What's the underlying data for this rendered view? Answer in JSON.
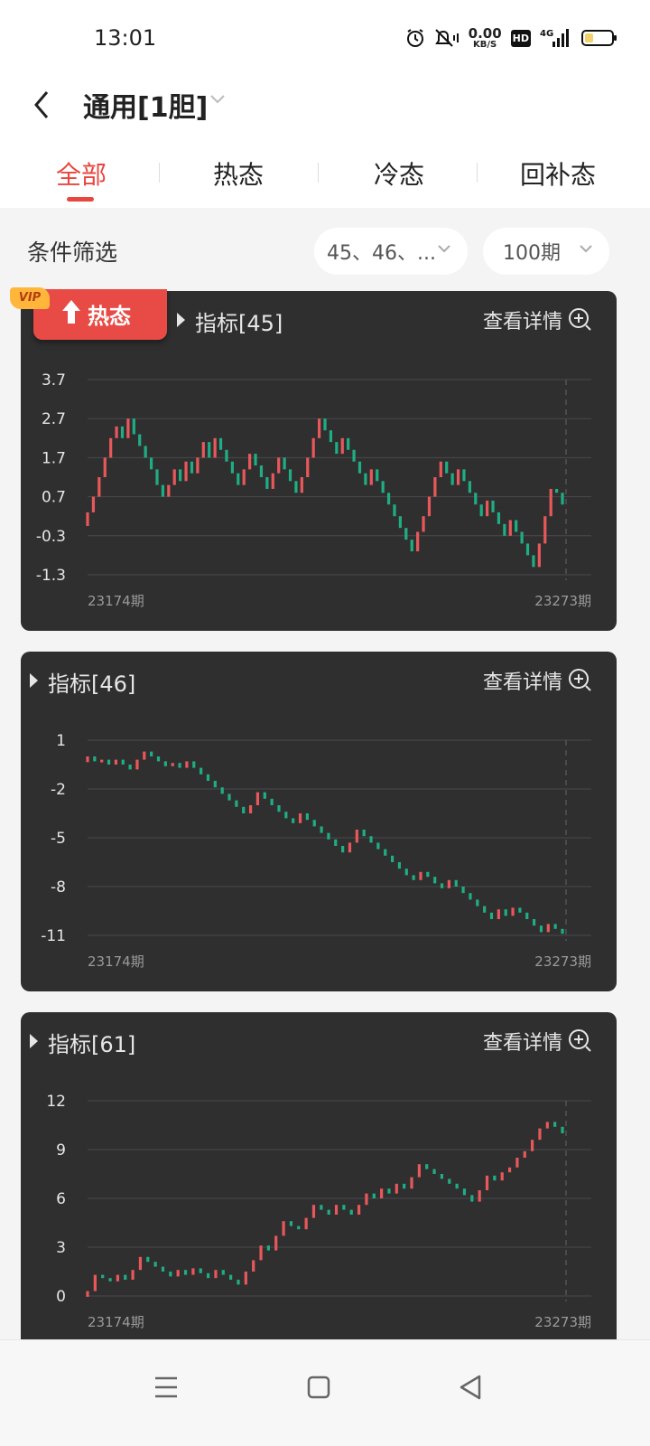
{
  "status_bar": {
    "time": "13:01",
    "net_speed_value": "0.00",
    "net_speed_unit": "KB/S",
    "hd_badge": "HD",
    "network": "4G",
    "icons": [
      "alarm-icon",
      "mute-icon",
      "signal-icon",
      "battery-icon"
    ]
  },
  "header": {
    "title": "通用[1胆]",
    "back_icon": "chevron-left-icon",
    "dropdown_icon": "chevron-down-icon"
  },
  "tabs": [
    {
      "label": "全部",
      "active": true
    },
    {
      "label": "热态",
      "active": false
    },
    {
      "label": "冷态",
      "active": false
    },
    {
      "label": "回补态",
      "active": false
    }
  ],
  "filter": {
    "label": "条件筛选",
    "indicators_value": "45、46、...",
    "periods_value": "100期"
  },
  "colors": {
    "accent": "#e8463f",
    "card_bg": "#2f2f30",
    "up_bar": "#e8585a",
    "down_bar": "#1fae83"
  },
  "cards": [
    {
      "name": "指标[45]",
      "detail_label": "查看详情",
      "badge": {
        "vip": "VIP",
        "text": "热态",
        "icon": "arrow-up-icon"
      },
      "chart_data": {
        "type": "line",
        "y_ticks": [
          "3.7",
          "2.7",
          "1.7",
          "0.7",
          "-0.3",
          "-1.3"
        ],
        "ylim": [
          -1.3,
          3.7
        ],
        "x_start_label": "23174期",
        "x_end_label": "23273期",
        "values": [
          0.3,
          0.7,
          1.2,
          1.7,
          2.2,
          2.5,
          2.2,
          2.7,
          2.3,
          2.0,
          1.7,
          1.4,
          1.0,
          0.7,
          1.0,
          1.4,
          1.1,
          1.6,
          1.3,
          1.7,
          2.1,
          1.7,
          2.2,
          1.9,
          1.6,
          1.3,
          1.0,
          1.4,
          1.8,
          1.5,
          1.2,
          0.9,
          1.3,
          1.7,
          1.4,
          1.1,
          0.8,
          1.2,
          1.7,
          2.2,
          2.7,
          2.4,
          2.1,
          1.8,
          2.2,
          1.9,
          1.6,
          1.3,
          1.0,
          1.4,
          1.1,
          0.8,
          0.5,
          0.2,
          -0.1,
          -0.4,
          -0.7,
          -0.2,
          0.2,
          0.7,
          1.2,
          1.6,
          1.3,
          1.0,
          1.4,
          1.1,
          0.8,
          0.5,
          0.2,
          0.6,
          0.3,
          0.0,
          -0.3,
          0.1,
          -0.2,
          -0.5,
          -0.8,
          -1.1,
          -0.5,
          0.2,
          0.9,
          0.8,
          0.5
        ]
      }
    },
    {
      "name": "指标[46]",
      "detail_label": "查看详情",
      "chart_data": {
        "type": "line",
        "y_ticks": [
          "1",
          "-2",
          "-5",
          "-8",
          "-11"
        ],
        "ylim": [
          -11,
          1
        ],
        "x_start_label": "23174期",
        "x_end_label": "23273期",
        "values": [
          0,
          -0.3,
          -0.2,
          -0.5,
          -0.2,
          -0.5,
          -0.8,
          -0.2,
          0.3,
          0,
          -0.3,
          -0.6,
          -0.4,
          -0.7,
          -0.3,
          -0.7,
          -1.1,
          -1.5,
          -1.9,
          -2.3,
          -2.7,
          -3.1,
          -3.5,
          -3.0,
          -2.2,
          -2.6,
          -3.0,
          -3.4,
          -3.8,
          -4.1,
          -3.5,
          -3.9,
          -4.3,
          -4.7,
          -5.1,
          -5.5,
          -5.9,
          -5.3,
          -4.5,
          -4.9,
          -5.3,
          -5.7,
          -6.1,
          -6.5,
          -6.9,
          -7.3,
          -7.6,
          -7.1,
          -7.4,
          -7.8,
          -8.1,
          -7.6,
          -8.0,
          -8.4,
          -8.8,
          -9.2,
          -9.6,
          -10.0,
          -9.4,
          -9.8,
          -9.3,
          -9.6,
          -10.0,
          -10.4,
          -10.8,
          -10.3,
          -10.6,
          -10.9
        ]
      }
    },
    {
      "name": "指标[61]",
      "detail_label": "查看详情",
      "chart_data": {
        "type": "line",
        "y_ticks": [
          "12",
          "9",
          "6",
          "3",
          "0"
        ],
        "ylim": [
          0,
          12
        ],
        "x_start_label": "23174期",
        "x_end_label": "23273期",
        "values": [
          0.3,
          1.3,
          1.1,
          0.9,
          1.3,
          1.0,
          1.6,
          2.4,
          2.1,
          1.8,
          1.5,
          1.2,
          1.6,
          1.3,
          1.7,
          1.4,
          1.1,
          1.6,
          1.3,
          1.0,
          0.7,
          1.5,
          2.2,
          3.1,
          2.8,
          3.7,
          4.6,
          4.3,
          4.1,
          4.8,
          5.6,
          5.3,
          5.0,
          5.6,
          5.3,
          5.0,
          5.6,
          6.3,
          6.0,
          6.6,
          6.3,
          6.9,
          6.6,
          7.3,
          8.1,
          7.8,
          7.5,
          7.2,
          6.9,
          6.6,
          6.2,
          5.8,
          6.5,
          7.4,
          7.1,
          7.6,
          7.9,
          8.5,
          8.9,
          9.6,
          10.3,
          10.7,
          10.4,
          10.0
        ]
      }
    }
  ],
  "nav_bar": {
    "icons": [
      "menu-icon",
      "home-square-icon",
      "back-triangle-icon"
    ]
  }
}
